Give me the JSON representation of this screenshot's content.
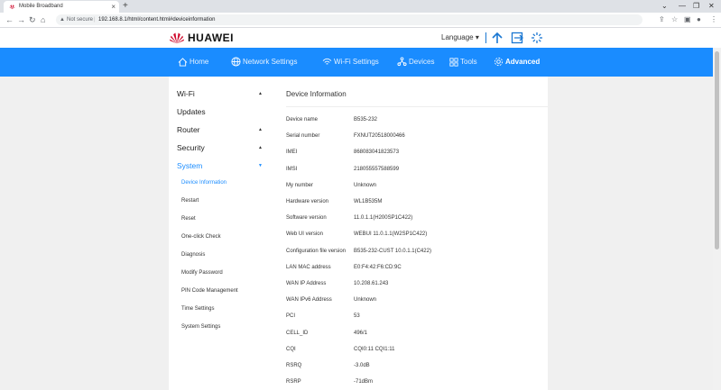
{
  "browser": {
    "tab_title": "Mobile Broadband",
    "tab_close": "×",
    "new_tab": "+",
    "not_secure": "Not secure",
    "url_sep": "|",
    "url": "192.168.8.1/html/content.html#deviceinformation",
    "win_min": "⌄",
    "win_restore": "—",
    "win_max": "❐",
    "win_close": "✕"
  },
  "header": {
    "brand": "HUAWEI",
    "language": "Language ▾",
    "brand_color": "#cf0a2c",
    "accent_color": "#1a77d2"
  },
  "nav": {
    "color": "#1a8cff",
    "items": [
      {
        "label": "Home",
        "icon": "home-icon"
      },
      {
        "label": "Network Settings",
        "icon": "globe-icon"
      },
      {
        "label": "Wi-Fi Settings",
        "icon": "wifi-icon"
      },
      {
        "label": "Devices",
        "icon": "devices-icon"
      },
      {
        "label": "Tools",
        "icon": "tools-icon"
      },
      {
        "label": "Advanced",
        "icon": "gear-icon",
        "active": true
      }
    ]
  },
  "sidebar": {
    "sections": [
      {
        "label": "Wi-Fi",
        "arrow": "▲"
      },
      {
        "label": "Updates",
        "arrow": ""
      },
      {
        "label": "Router",
        "arrow": "▲"
      },
      {
        "label": "Security",
        "arrow": "▲"
      },
      {
        "label": "System",
        "arrow": "▼",
        "open": true
      }
    ],
    "sub_items": [
      {
        "label": "Device Information",
        "active": true
      },
      {
        "label": "Restart"
      },
      {
        "label": "Reset"
      },
      {
        "label": "One-click Check"
      },
      {
        "label": "Diagnosis"
      },
      {
        "label": "Modify Password"
      },
      {
        "label": "PIN Code Management"
      },
      {
        "label": "Time Settings"
      },
      {
        "label": "System Settings"
      }
    ]
  },
  "main": {
    "title": "Device Information",
    "rows": [
      {
        "key": "Device name",
        "value": "B535-232"
      },
      {
        "key": "Serial number",
        "value": "FXNUT20518000466"
      },
      {
        "key": "IMEI",
        "value": "868083041823573"
      },
      {
        "key": "IMSI",
        "value": "218055557588599"
      },
      {
        "key": "My number",
        "value": "Unknown"
      },
      {
        "key": "Hardware version",
        "value": "WL1B535M"
      },
      {
        "key": "Software version",
        "value": "11.0.1.1(H200SP1C422)"
      },
      {
        "key": "Web UI version",
        "value": "WEBUI 11.0.1.1(W2SP1C422)"
      },
      {
        "key": "Configuration file version",
        "value": "B535-232-CUST 10.0.1.1(C422)"
      },
      {
        "key": "LAN MAC address",
        "value": "E0:F4:42:F6:CD:9C"
      },
      {
        "key": "WAN IP Address",
        "value": "10.208.61.243"
      },
      {
        "key": "WAN IPv6 Address",
        "value": "Unknown"
      },
      {
        "key": "PCI",
        "value": "53"
      },
      {
        "key": "CELL_ID",
        "value": "496/1"
      },
      {
        "key": "CQI",
        "value": "CQI0:11 CQI1:11"
      },
      {
        "key": "RSRQ",
        "value": "-3.0dB"
      },
      {
        "key": "RSRP",
        "value": "-71dBm"
      }
    ]
  }
}
